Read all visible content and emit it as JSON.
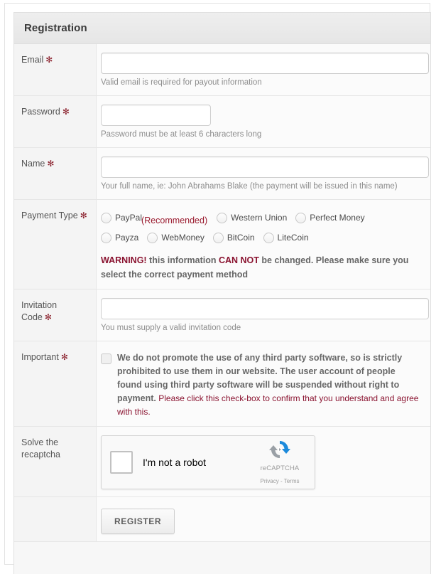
{
  "panel": {
    "title": "Registration"
  },
  "required_marker": "✻",
  "colors": {
    "accent_red": "#8a1330",
    "label_gray": "#555555",
    "hint_gray": "#8d8d8d",
    "panel_bg": "#f7f7f7",
    "header_bg": "#eaeaea"
  },
  "fields": {
    "email": {
      "label": "Email",
      "required": true,
      "value": "",
      "placeholder": "",
      "hint": "Valid email is required for payout information"
    },
    "password": {
      "label": "Password",
      "required": true,
      "value": "",
      "placeholder": "",
      "hint": "Password must be at least 6 characters long"
    },
    "name": {
      "label": "Name",
      "required": true,
      "value": "",
      "placeholder": "",
      "hint": "Your full name, ie: John Abrahams Blake (the payment will be issued in this name)"
    },
    "payment_type": {
      "label": "Payment Type",
      "required": true,
      "options_row1": [
        {
          "label": "PayPal",
          "note": "(Recommended)",
          "selected": false
        },
        {
          "label": "Western Union",
          "note": "",
          "selected": false
        },
        {
          "label": "Perfect Money",
          "note": "",
          "selected": false
        }
      ],
      "options_row2": [
        {
          "label": "Payza",
          "note": "",
          "selected": false
        },
        {
          "label": "WebMoney",
          "note": "",
          "selected": false
        },
        {
          "label": "BitCoin",
          "note": "",
          "selected": false
        },
        {
          "label": "LiteCoin",
          "note": "",
          "selected": false
        }
      ],
      "warning": {
        "lead": "WARNING!",
        "mid1": " this information ",
        "emphasis": "CAN NOT",
        "mid2": " be changed. Please make sure you select the correct payment method"
      }
    },
    "invitation_code": {
      "label": "Invitation Code",
      "required": true,
      "value": "",
      "placeholder": "",
      "hint": "You must supply a valid invitation code"
    },
    "important": {
      "label": "Important",
      "required": true,
      "checked": false,
      "text_bold": "We do not promote the use of any third party software, so is strictly prohibited to use them in our website. The user account of people found using third party software will be suspended without right to payment.",
      "text_red": " Please click this check-box to confirm that you understand and agree with this."
    },
    "recaptcha": {
      "label": "Solve the recaptcha",
      "required": false,
      "checkbox_label": "I'm not a robot",
      "brand": "reCAPTCHA",
      "terms": "Privacy - Terms",
      "checked": false
    }
  },
  "submit": {
    "label": "REGISTER"
  }
}
